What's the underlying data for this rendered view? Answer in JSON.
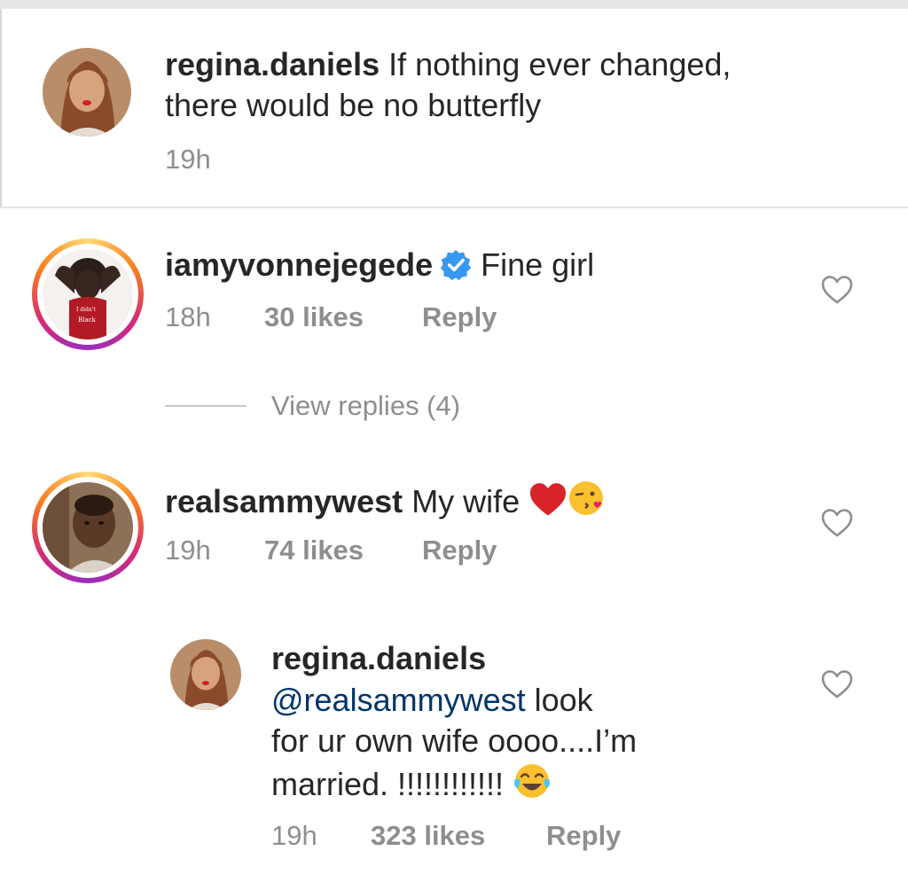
{
  "comments": [
    {
      "username": "regina.daniels",
      "text": "If nothing ever changed,",
      "text2": "there would be no butterfly",
      "time": "19h"
    },
    {
      "username": "iamyvonnejegede",
      "text": "Fine girl",
      "time": "18h",
      "likes": "30 likes",
      "reply": "Reply",
      "view_replies": "View replies (4)"
    },
    {
      "username": "realsammywest",
      "text": "My wife",
      "time": "19h",
      "likes": "74 likes",
      "reply": "Reply"
    },
    {
      "username": "regina.daniels",
      "mention": "@realsammywest",
      "text_a": "look",
      "text_b": "for ur own wife oooo....I’m",
      "text_c": "married. !!!!!!!!!!!!",
      "time": "19h",
      "likes": "323 likes",
      "reply": "Reply"
    }
  ],
  "icons": {
    "heart": "heart-outline-icon",
    "verified": "verified-badge-icon",
    "emoji_heart": "red-heart-emoji",
    "emoji_kiss": "face-blowing-kiss-emoji",
    "emoji_laugh": "face-with-tears-of-joy-emoji"
  },
  "colors": {
    "text": "#262626",
    "meta": "#8e8e8e",
    "mention": "#003569",
    "verified": "#3897f0"
  }
}
